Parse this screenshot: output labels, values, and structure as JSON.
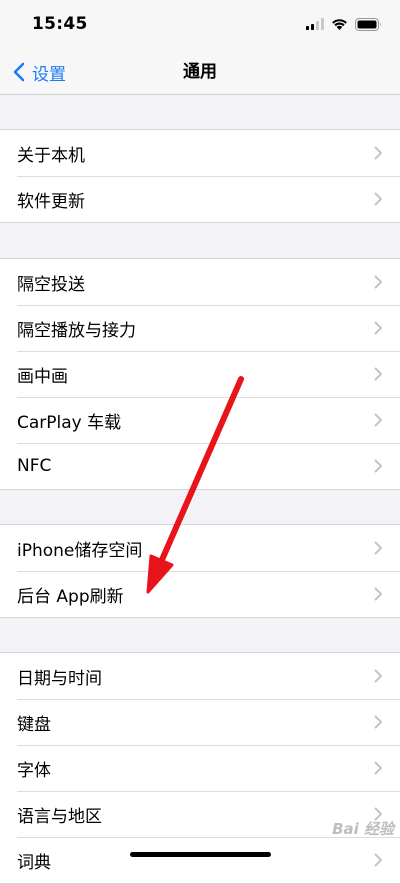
{
  "status_bar": {
    "time": "15:45"
  },
  "nav": {
    "back_label": "设置",
    "title": "通用"
  },
  "groups": [
    {
      "items": [
        {
          "label": "关于本机"
        },
        {
          "label": "软件更新"
        }
      ]
    },
    {
      "items": [
        {
          "label": "隔空投送"
        },
        {
          "label": "隔空播放与接力"
        },
        {
          "label": "画中画"
        },
        {
          "label": "CarPlay 车载"
        },
        {
          "label": "NFC"
        }
      ]
    },
    {
      "items": [
        {
          "label": "iPhone储存空间"
        },
        {
          "label": "后台 App刷新"
        }
      ]
    },
    {
      "items": [
        {
          "label": "日期与时间"
        },
        {
          "label": "键盘"
        },
        {
          "label": "字体"
        },
        {
          "label": "语言与地区"
        },
        {
          "label": "词典"
        }
      ]
    }
  ],
  "annotation": {
    "arrow_color": "#e8141b"
  },
  "watermark": {
    "text": "Bai 经验"
  },
  "colors": {
    "accent": "#1a7cf5",
    "background": "#f2f2f7",
    "chevron": "#c4c4c7"
  }
}
